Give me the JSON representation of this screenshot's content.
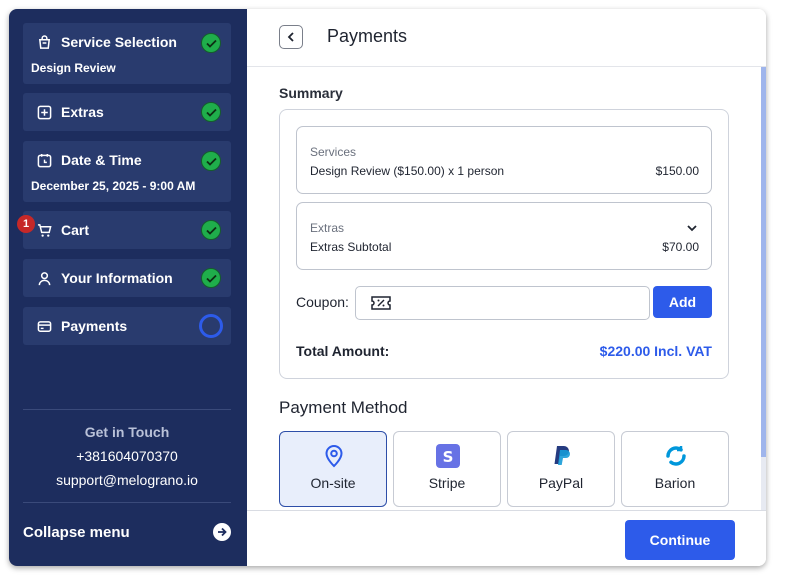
{
  "sidebar": {
    "steps": [
      {
        "title": "Service Selection",
        "sub": "Design Review",
        "icon": "bag-icon",
        "status": "done"
      },
      {
        "title": "Extras",
        "sub": "",
        "icon": "plus-square-icon",
        "status": "done"
      },
      {
        "title": "Date & Time",
        "sub": "December 25, 2025 - 9:00 AM",
        "icon": "calendar-icon",
        "status": "done"
      },
      {
        "title": "Cart",
        "sub": "",
        "icon": "cart-icon",
        "status": "done",
        "badge": "1"
      },
      {
        "title": "Your Information",
        "sub": "",
        "icon": "user-icon",
        "status": "done"
      },
      {
        "title": "Payments",
        "sub": "",
        "icon": "card-icon",
        "status": "current"
      }
    ],
    "contact": {
      "heading": "Get in Touch",
      "phone": "+381604070370",
      "email": "support@melograno.io"
    },
    "collapse_label": "Collapse menu"
  },
  "main": {
    "title": "Payments",
    "summary": {
      "heading": "Summary",
      "services": {
        "caption": "Services",
        "description": "Design Review ($150.00) x 1 person",
        "amount": "$150.00"
      },
      "extras": {
        "caption": "Extras",
        "description": "Extras Subtotal",
        "amount": "$70.00"
      },
      "coupon": {
        "label": "Coupon:",
        "value": "",
        "placeholder": "",
        "button": "Add"
      },
      "total": {
        "label": "Total Amount:",
        "value": "$220.00 Incl. VAT"
      }
    },
    "payment_method": {
      "heading": "Payment Method",
      "options": [
        {
          "label": "On-site",
          "icon": "location-pin-icon",
          "selected": true
        },
        {
          "label": "Stripe",
          "icon": "stripe-icon",
          "selected": false
        },
        {
          "label": "PayPal",
          "icon": "paypal-icon",
          "selected": false
        },
        {
          "label": "Barion",
          "icon": "barion-icon",
          "selected": false
        }
      ]
    },
    "continue_label": "Continue"
  },
  "colors": {
    "sidebar_bg": "#1d2d5e",
    "step_bg": "#293b6e",
    "accent": "#2d5bea",
    "success": "#1fae4b",
    "badge": "#c62828"
  }
}
